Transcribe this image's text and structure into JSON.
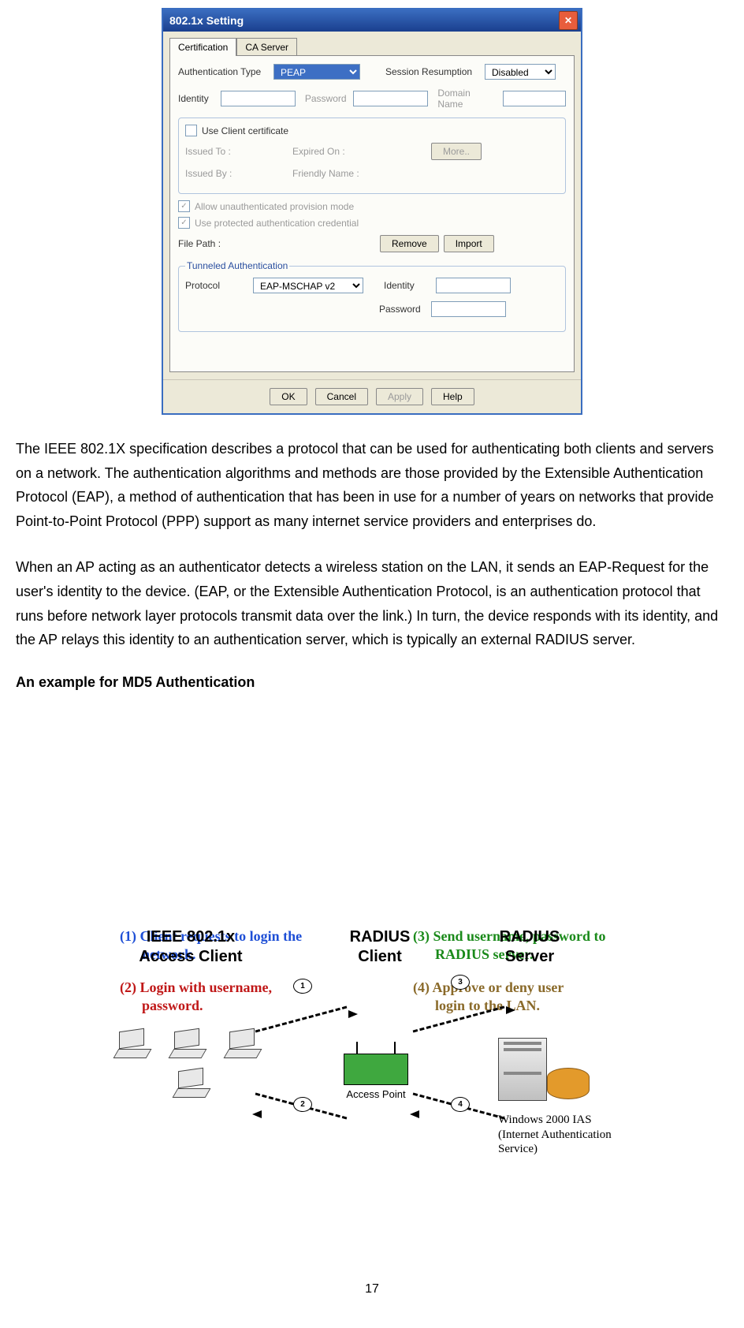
{
  "dialog": {
    "title": "802.1x Setting",
    "close_glyph": "✕",
    "tabs": {
      "certification": "Certification",
      "ca_server": "CA Server"
    },
    "auth_type_label": "Authentication Type",
    "auth_type_value": "PEAP",
    "session_resumption_label": "Session Resumption",
    "session_resumption_value": "Disabled",
    "identity_label": "Identity",
    "password_label": "Password",
    "domain_name_label": "Domain Name",
    "use_client_cert_label": "Use Client certificate",
    "issued_to_label": "Issued To :",
    "expired_on_label": "Expired On :",
    "issued_by_label": "Issued By :",
    "friendly_name_label": "Friendly Name :",
    "more_button": "More..",
    "allow_unauth_label": "Allow unauthenticated provision mode",
    "use_protected_label": "Use protected authentication credential",
    "file_path_label": "File Path :",
    "remove_button": "Remove",
    "import_button": "Import",
    "tunneled_auth_label": "Tunneled Authentication",
    "protocol_label": "Protocol",
    "protocol_value": "EAP-MSCHAP v2",
    "tun_identity_label": "Identity",
    "tun_password_label": "Password",
    "ok_button": "OK",
    "cancel_button": "Cancel",
    "apply_button": "Apply",
    "help_button": "Help"
  },
  "body": {
    "para1": "The IEEE 802.1X specification describes a protocol that can be used for authenticating both clients and servers on a network. The authentication algorithms and methods are those provided by the Extensible Authentication Protocol (EAP), a method of authentication that has been in use for a number of years on networks that provide Point-to-Point Protocol (PPP) support as many internet service providers and enterprises do.",
    "para2": "When an AP acting as an authenticator detects a wireless station on the LAN, it sends an EAP-Request for the user's identity to the device. (EAP, or the Extensible Authentication Protocol, is an authentication protocol that runs before network layer protocols transmit data over the link.) In turn, the device responds with its identity, and the AP relays this identity to an authentication server, which is typically an external RADIUS server.",
    "example_heading": "An example for MD5 Authentication"
  },
  "diagram": {
    "access_client_line1": "IEEE 802.1x",
    "access_client_line2": "Access Client",
    "radius_client_line1": "RADIUS",
    "radius_client_line2": "Client",
    "radius_server_line1": "RADIUS",
    "radius_server_line2": "Server",
    "access_point_label": "Access Point",
    "markers": {
      "m1": "1",
      "m2": "2",
      "m3": "3",
      "m4": "4"
    },
    "server_line1": "Windows 2000 IAS",
    "server_line2": "(Internet Authentication",
    "server_line3": " Service)",
    "step1a": "(1) Client requests to login the",
    "step1b": "network.",
    "step2a": "(2) Login with username,",
    "step2b": "password.",
    "step3a": "(3) Send username, password to",
    "step3b": "RADIUS server.",
    "step4a": "(4) Approve or deny user",
    "step4b": "login to the LAN."
  },
  "page_number": "17"
}
